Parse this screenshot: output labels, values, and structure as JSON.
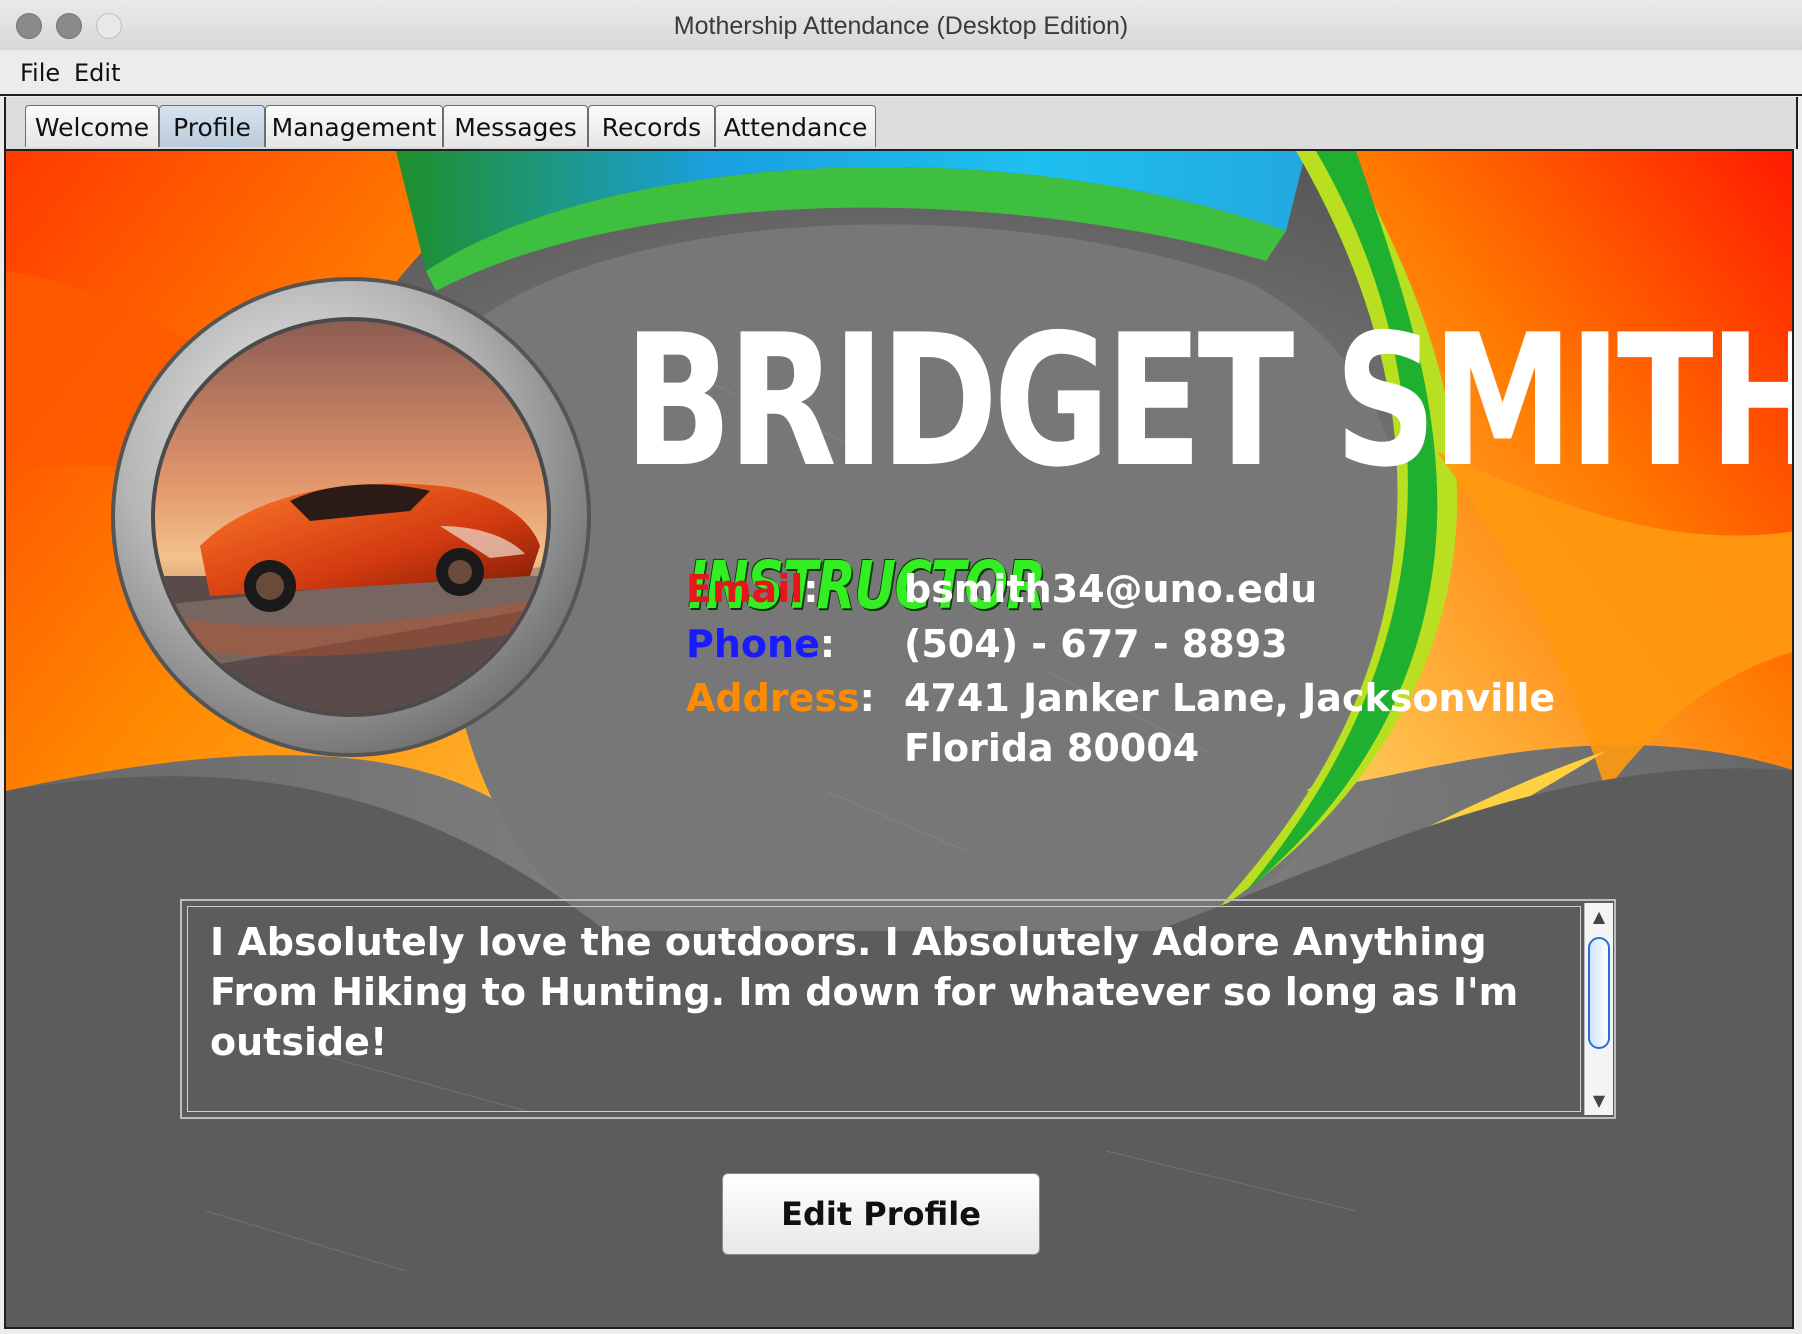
{
  "window": {
    "title": "Mothership Attendance (Desktop Edition)"
  },
  "menu": {
    "items": [
      "File",
      "Edit"
    ]
  },
  "tabs": [
    {
      "label": "Welcome",
      "active": false
    },
    {
      "label": "Profile",
      "active": true
    },
    {
      "label": "Management",
      "active": false
    },
    {
      "label": "Messages",
      "active": false
    },
    {
      "label": "Records",
      "active": false
    },
    {
      "label": "Attendance",
      "active": false
    }
  ],
  "profile": {
    "name": "BRIDGET SMITH",
    "role": "INSTRUCTOR",
    "avatar_icon": "sports-car-photo",
    "email_label": "Email",
    "email_value": "bsmith34@uno.edu",
    "phone_label": "Phone",
    "phone_value": "(504) - 677 - 8893",
    "address_label": "Address",
    "address_line1": "4741 Janker Lane, Jacksonville",
    "address_line2": "Florida 80004",
    "colon": ":",
    "bio": "I Absolutely love the outdoors. I Absolutely Adore Anything From Hiking to Hunting. Im down for whatever so long as I'm outside!"
  },
  "actions": {
    "edit_profile_label": "Edit Profile"
  },
  "colors": {
    "email_label": "#e8161a",
    "phone_label": "#1a1aff",
    "address_label": "#ff8c00",
    "role": "#33ee22",
    "background_dark": "#6a6a6a"
  }
}
